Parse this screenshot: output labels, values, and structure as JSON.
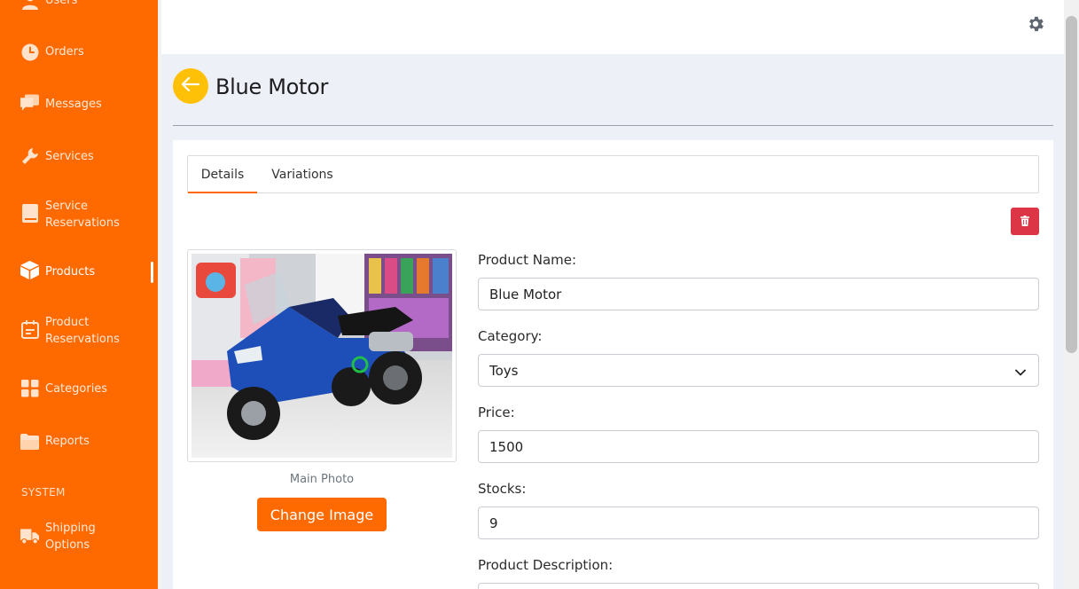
{
  "sidebar": {
    "items": [
      {
        "label": "Users",
        "icon": "user-icon"
      },
      {
        "label": "Orders",
        "icon": "clock-icon"
      },
      {
        "label": "Messages",
        "icon": "chat-icon"
      },
      {
        "label": "Services",
        "icon": "wrench-icon"
      },
      {
        "label": "Service\nReservations",
        "icon": "book-icon"
      },
      {
        "label": "Products",
        "icon": "box-icon",
        "active": true
      },
      {
        "label": "Product\nReservations",
        "icon": "calendar-icon"
      },
      {
        "label": "Categories",
        "icon": "grid-icon"
      },
      {
        "label": "Reports",
        "icon": "folder-icon"
      }
    ],
    "section_system": "SYSTEM",
    "system_items": [
      {
        "label": "Shipping\nOptions",
        "icon": "truck-icon"
      }
    ]
  },
  "topbar": {
    "settings_icon": "gear-icon"
  },
  "header": {
    "title": "Blue Motor",
    "back_icon": "arrow-left-icon"
  },
  "tabs": [
    {
      "label": "Details",
      "active": true
    },
    {
      "label": "Variations",
      "active": false
    }
  ],
  "photo": {
    "caption": "Main Photo",
    "change_label": "Change Image"
  },
  "form": {
    "product_name_label": "Product Name:",
    "product_name_value": "Blue Motor",
    "category_label": "Category:",
    "category_value": "Toys",
    "price_label": "Price:",
    "price_value": "1500",
    "stocks_label": "Stocks:",
    "stocks_value": "9",
    "description_label": "Product Description:"
  },
  "colors": {
    "brand": "#ff6a00",
    "back_button": "#ffc107",
    "delete_button": "#dc3545"
  }
}
